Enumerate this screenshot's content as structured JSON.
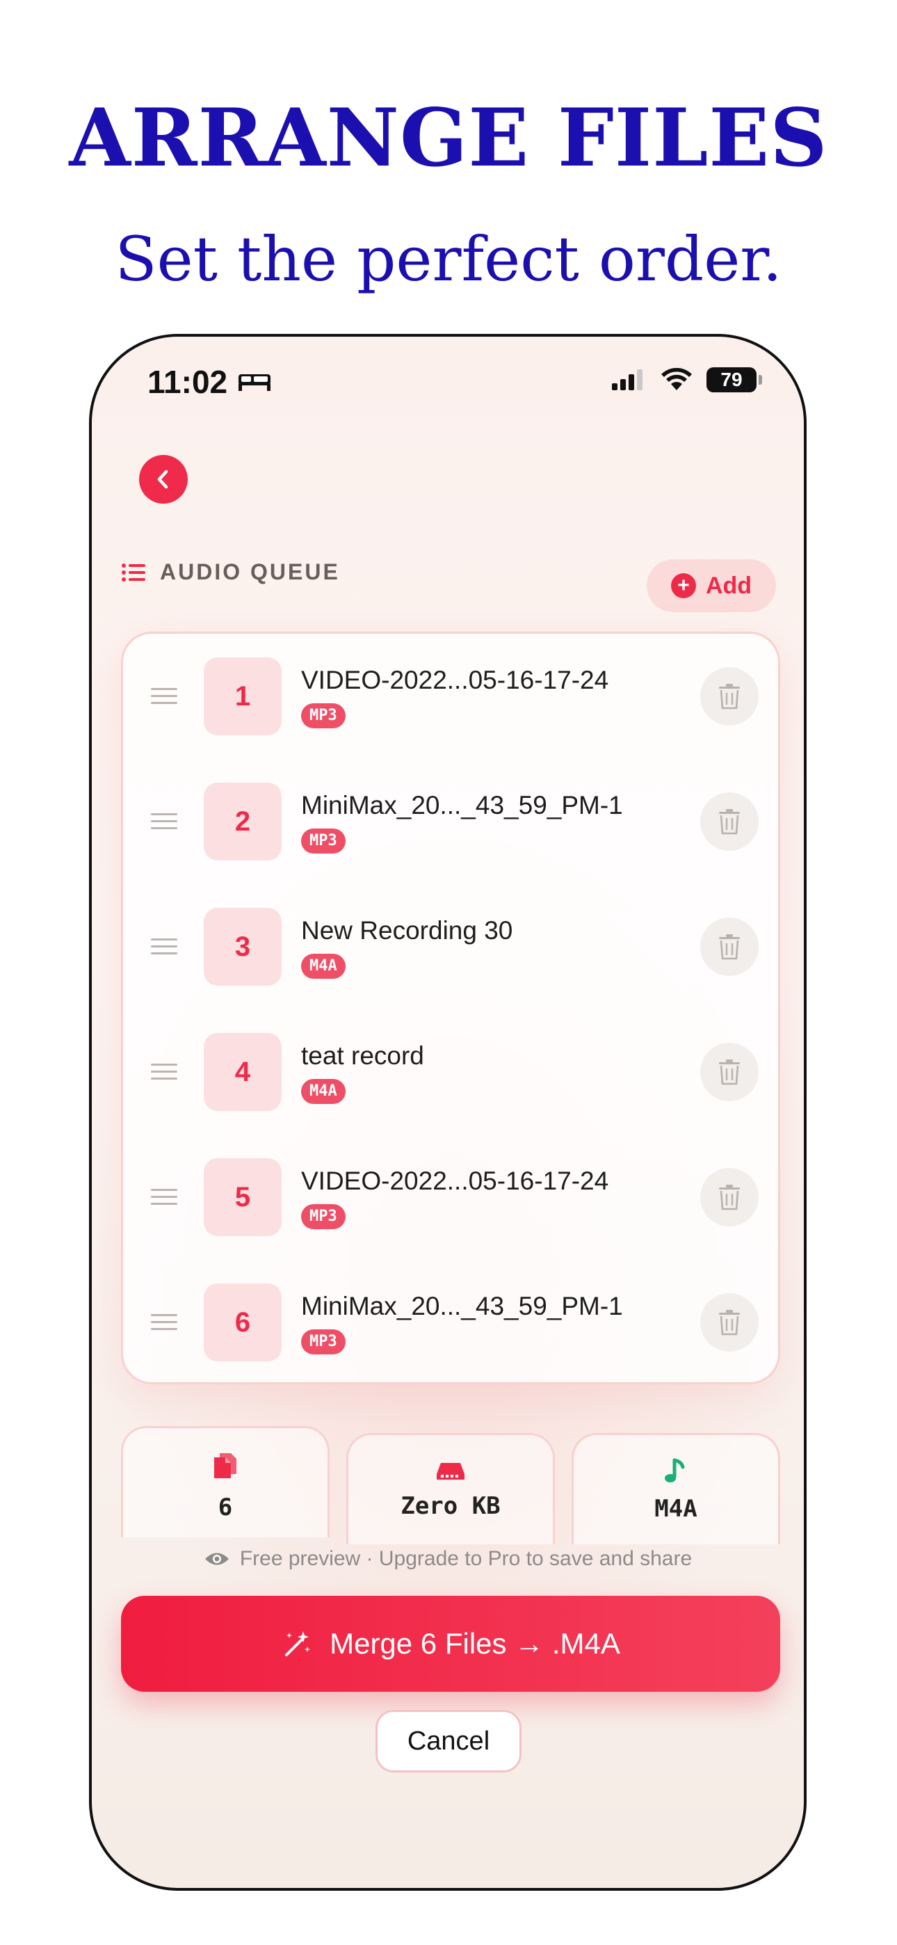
{
  "promo": {
    "title": "ARRANGE FILES",
    "subtitle": "Set the perfect order."
  },
  "status_bar": {
    "time": "11:02",
    "battery": "79"
  },
  "queue": {
    "title": "AUDIO QUEUE",
    "add_label": "Add",
    "items": [
      {
        "index": "1",
        "name": "VIDEO-2022...05-16-17-24",
        "format": "MP3"
      },
      {
        "index": "2",
        "name": "MiniMax_20..._43_59_PM-1",
        "format": "MP3"
      },
      {
        "index": "3",
        "name": "New Recording 30",
        "format": "M4A"
      },
      {
        "index": "4",
        "name": "teat record",
        "format": "M4A"
      },
      {
        "index": "5",
        "name": "VIDEO-2022...05-16-17-24",
        "format": "MP3"
      },
      {
        "index": "6",
        "name": "MiniMax_20..._43_59_PM-1",
        "format": "MP3"
      }
    ]
  },
  "stats": {
    "files": "6",
    "size": "Zero KB",
    "format": "M4A"
  },
  "colors": {
    "accent": "#ee2a49",
    "promo_blue": "#1c0fb0",
    "format_green": "#17b07a"
  },
  "preview_note": "Free preview · Upgrade to Pro to save and share",
  "merge_label": "Merge 6 Files → .M4A",
  "cancel_label": "Cancel"
}
